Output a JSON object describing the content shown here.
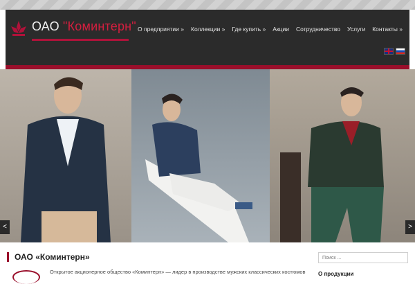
{
  "header": {
    "logo_prefix": "ОАО",
    "logo_brand": "\"Коминтерн\""
  },
  "nav": [
    {
      "label": "О предприятии »"
    },
    {
      "label": "Коллекции »"
    },
    {
      "label": "Где купить »"
    },
    {
      "label": "Акции"
    },
    {
      "label": "Сотрудничество"
    },
    {
      "label": "Услуги"
    },
    {
      "label": "Контакты »"
    }
  ],
  "slider": {
    "prev_label": "<",
    "next_label": ">"
  },
  "content": {
    "title": "ОАО «Коминтерн»",
    "intro": "Открытое акционерное общество «Коминтерн» — лидер в производстве мужских классических костюмов"
  },
  "sidebar": {
    "search_placeholder": "Поиск ...",
    "heading": "О продукции"
  },
  "colors": {
    "accent": "#9a0f2b",
    "header_bg": "#2b2b2b"
  }
}
